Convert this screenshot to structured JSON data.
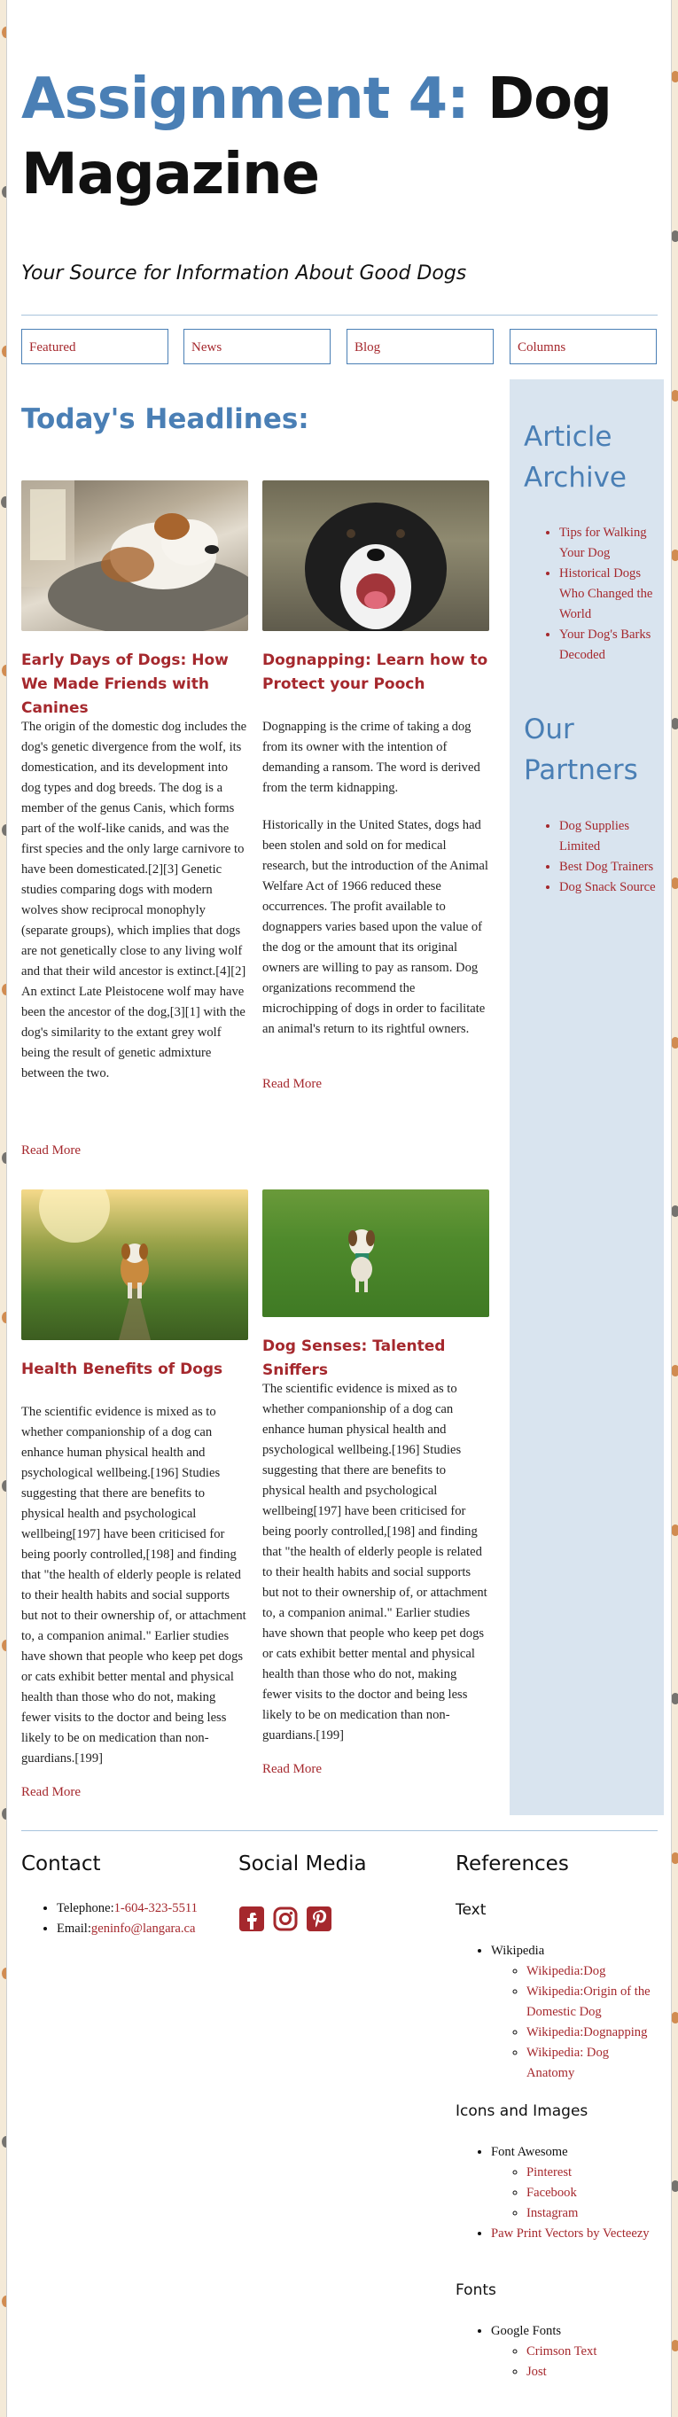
{
  "header": {
    "title_accent": "Assignment 4:",
    "title_rest": "Dog Magazine",
    "tagline": "Your Source for Information About Good Dogs"
  },
  "nav": {
    "items": [
      "Featured",
      "News",
      "Blog",
      "Columns"
    ]
  },
  "main": {
    "heading": "Today's Headlines:",
    "articles": [
      {
        "title": "Early Days of Dogs: How We Made Friends with Canines",
        "body": "The origin of the domestic dog includes the dog's genetic divergence from the wolf, its domestication, and its development into dog types and dog breeds. The dog is a member of the genus Canis, which forms part of the wolf-like canids, and was the first species and the only large carnivore to have been domesticated.[2][3] Genetic studies comparing dogs with modern wolves show reciprocal monophyly (separate groups), which implies that dogs are not genetically close to any living wolf and that their wild ancestor is extinct.[4][2] An extinct Late Pleistocene wolf may have been the ancestor of the dog,[3][1] with the dog's similarity to the extant grey wolf being the result of genetic admixture between the two.",
        "read_more": "Read More"
      },
      {
        "title": "Dognapping: Learn how to Protect your Pooch",
        "body1": "Dognapping is the crime of taking a dog from its owner with the intention of demanding a ransom. The word is derived from the term kidnapping.",
        "body2": "Historically in the United States, dogs had been stolen and sold on for medical research, but the introduction of the Animal Welfare Act of 1966 reduced these occurrences. The profit available to dognappers varies based upon the value of the dog or the amount that its original owners are willing to pay as ransom. Dog organizations recommend the microchipping of dogs in order to facilitate an animal's return to its rightful owners.",
        "read_more": "Read More"
      },
      {
        "title": "Health Benefits of Dogs",
        "body": "The scientific evidence is mixed as to whether companionship of a dog can enhance human physical health and psychological wellbeing.[196] Studies suggesting that there are benefits to physical health and psychological wellbeing[197] have been criticised for being poorly controlled,[198] and finding that \"the health of elderly people is related to their health habits and social supports but not to their ownership of, or attachment to, a companion animal.\" Earlier studies have shown that people who keep pet dogs or cats exhibit better mental and physical health than those who do not, making fewer visits to the doctor and being less likely to be on medication than non-guardians.[199]",
        "read_more": "Read More"
      },
      {
        "title": "Dog Senses: Talented Sniffers",
        "body": "The scientific evidence is mixed as to whether companionship of a dog can enhance human physical health and psychological wellbeing.[196] Studies suggesting that there are benefits to physical health and psychological wellbeing[197] have been criticised for being poorly controlled,[198] and finding that \"the health of elderly people is related to their health habits and social supports but not to their ownership of, or attachment to, a companion animal.\" Earlier studies have shown that people who keep pet dogs or cats exhibit better mental and physical health than those who do not, making fewer visits to the doctor and being less likely to be on medication than non-guardians.[199]",
        "read_more": "Read More"
      }
    ]
  },
  "sidebar": {
    "archive_heading": "Article Archive",
    "archive_items": [
      "Tips for Walking Your Dog",
      "Historical Dogs Who Changed the World",
      "Your Dog's Barks Decoded"
    ],
    "partners_heading": "Our Partners",
    "partner_items": [
      "Dog Supplies Limited",
      "Best Dog Trainers",
      "Dog Snack Source"
    ]
  },
  "footer": {
    "contact_heading": "Contact",
    "telephone_label": "Telephone:",
    "telephone_value": "1-604-323-5511",
    "email_label": "Email:",
    "email_value": "geninfo@langara.ca",
    "social_heading": "Social Media",
    "social_icons": [
      "facebook-icon",
      "instagram-icon",
      "pinterest-icon"
    ],
    "references_heading": "References",
    "text_heading": "Text",
    "text_source": "Wikipedia",
    "text_links": [
      "Wikipedia:Dog",
      "Wikipedia:Origin of the Domestic Dog",
      "Wikipedia:Dognapping",
      "Wikipedia: Dog Anatomy"
    ],
    "icons_heading": "Icons and Images",
    "icons_source": "Font Awesome",
    "icons_links": [
      "Pinterest",
      "Facebook",
      "Instagram"
    ],
    "paw_link": "Paw Print Vectors by Vecteezy",
    "fonts_heading": "Fonts",
    "fonts_source": "Google Fonts",
    "fonts_links": [
      "Crimson Text",
      "Jost"
    ]
  },
  "colors": {
    "accent_blue": "#4a7fb5",
    "link_red": "#a5282d",
    "sidebar_bg": "#d9e4ef",
    "paw_brown": "#c8742f"
  }
}
